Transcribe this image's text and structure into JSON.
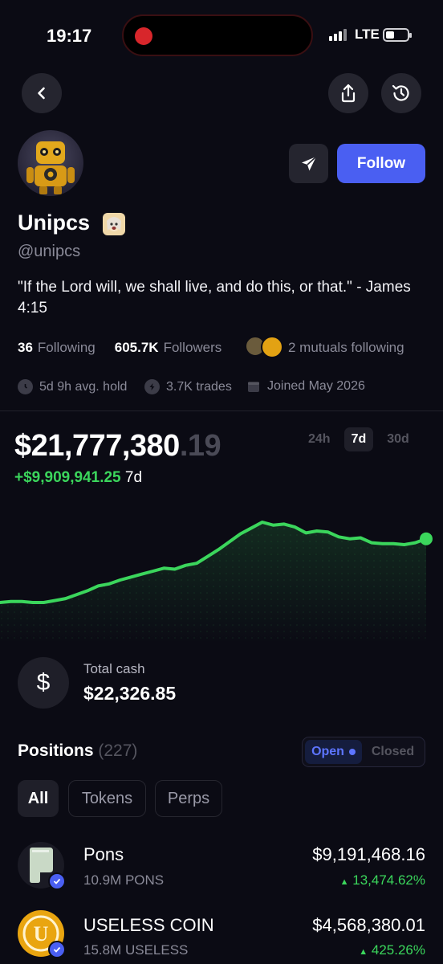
{
  "status_bar": {
    "time": "19:17",
    "network": "LTE"
  },
  "profile": {
    "name": "Unipcs",
    "handle": "@unipcs",
    "bio": "\"If the Lord will, we shall live, and do this, or that.\" - James 4:15",
    "follow_label": "Follow",
    "following_count": "36",
    "following_label": "Following",
    "followers_count": "605.7K",
    "followers_label": "Followers",
    "mutuals_text": "2 mutuals following",
    "avg_hold": "5d 9h avg. hold",
    "trades": "3.7K trades",
    "joined": "Joined May 2026"
  },
  "portfolio": {
    "value_main": "$21,777,380",
    "value_cents": ".19",
    "change": "+$9,909,941.25",
    "change_period": "7d",
    "range_tabs": [
      "24h",
      "7d",
      "30d"
    ],
    "active_range": "7d"
  },
  "chart_data": {
    "type": "line",
    "title": "",
    "xlabel": "",
    "ylabel": "",
    "color": "#3bd65c",
    "x": [
      0,
      1,
      2,
      3,
      4,
      5,
      6,
      7,
      8,
      9,
      10,
      11,
      12,
      13,
      14,
      15,
      16,
      17,
      18,
      19,
      20,
      21,
      22,
      23,
      24,
      25,
      26,
      27,
      28,
      29,
      30,
      31,
      32,
      33,
      34,
      35,
      36,
      37,
      38,
      39
    ],
    "values": [
      10,
      11,
      11,
      10,
      10,
      12,
      14,
      18,
      22,
      27,
      29,
      33,
      36,
      39,
      42,
      45,
      44,
      48,
      50,
      57,
      64,
      72,
      80,
      86,
      92,
      89,
      90,
      87,
      81,
      83,
      82,
      77,
      75,
      76,
      71,
      70,
      70,
      69,
      71,
      75
    ]
  },
  "cash": {
    "label": "Total cash",
    "value": "$22,326.85",
    "icon": "dollar-icon"
  },
  "positions": {
    "title": "Positions",
    "count": "(227)",
    "toggle": {
      "open": "Open",
      "closed": "Closed"
    },
    "filters": [
      "All",
      "Tokens",
      "Perps"
    ],
    "items": [
      {
        "name": "Pons",
        "amount": "10.9M PONS",
        "value": "$9,191,468.16",
        "change": "13,474.62%"
      },
      {
        "name": "USELESS COIN",
        "amount": "15.8M USELESS",
        "value": "$4,568,380.01",
        "change": "425.26%"
      }
    ]
  },
  "colors": {
    "accent": "#4a5ff2",
    "positive": "#3bd65c",
    "background": "#0b0b14"
  }
}
